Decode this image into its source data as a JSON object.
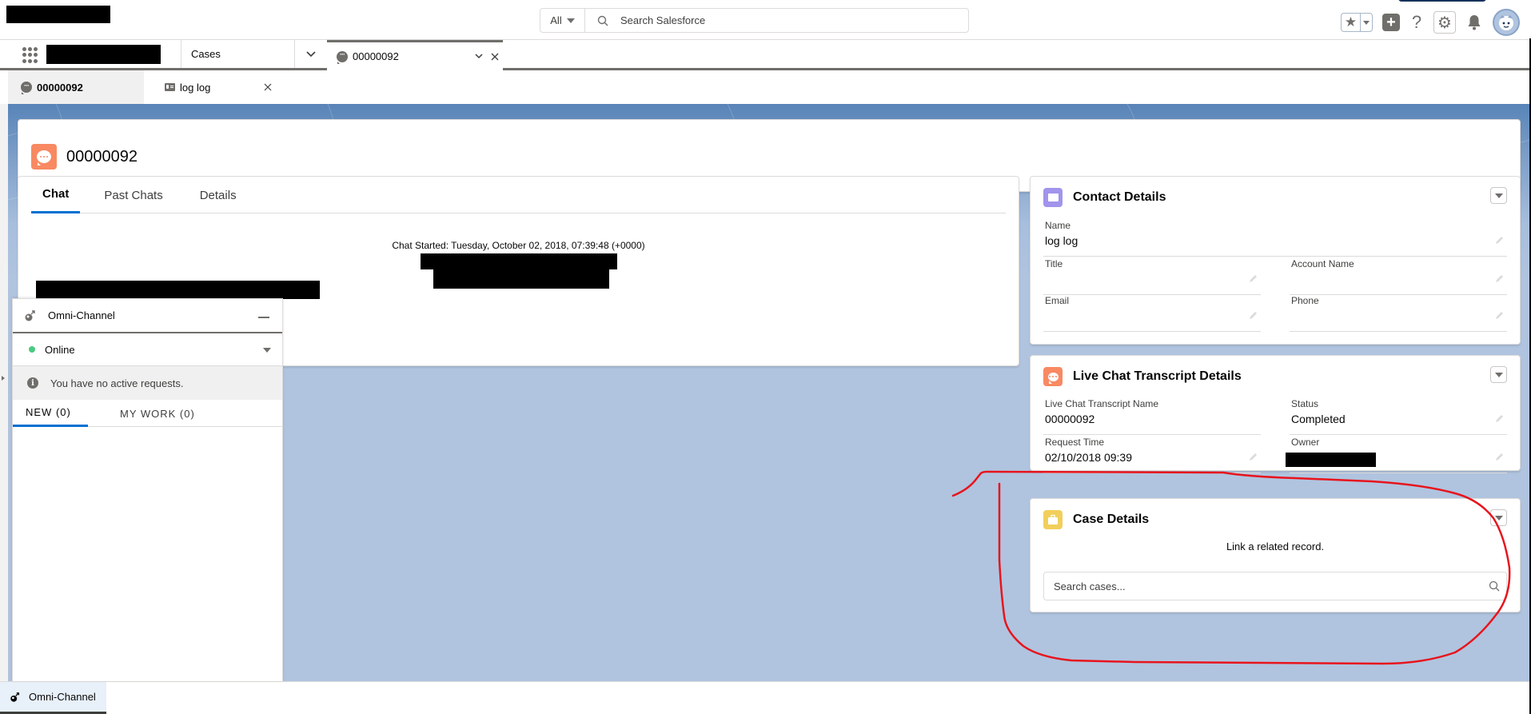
{
  "global_header": {
    "search_scope": "All",
    "search_placeholder": "Search Salesforce",
    "icons": [
      "favorites-star-icon",
      "favorites-dropdown-icon",
      "global-create-icon",
      "help-icon",
      "setup-gear-icon",
      "notifications-bell-icon",
      "user-avatar"
    ]
  },
  "nav": {
    "app_launcher_icon": "app-launcher-grid-icon",
    "object_tab_label": "Cases",
    "workspace_tab": {
      "label": "00000092",
      "icon": "chat-icon"
    }
  },
  "subtabs": [
    {
      "label": "00000092",
      "icon": "chat-icon",
      "active": true
    },
    {
      "label": "log log",
      "icon": "contact-icon",
      "active": false
    }
  ],
  "record": {
    "title": "00000092",
    "icon": "live-chat-transcript-icon",
    "icon_color": "#f88962"
  },
  "chat_card": {
    "tabs": [
      "Chat",
      "Past Chats",
      "Details"
    ],
    "active_tab": "Chat",
    "chat_started": "Chat Started: Tuesday, October 02, 2018, 07:39:48 (+0000)"
  },
  "contact_details": {
    "title": "Contact Details",
    "icon_color": "#a094ed",
    "fields": {
      "name_label": "Name",
      "name_value": "log log",
      "title_label": "Title",
      "title_value": "",
      "account_label": "Account Name",
      "account_value": "",
      "email_label": "Email",
      "email_value": "",
      "phone_label": "Phone",
      "phone_value": ""
    }
  },
  "transcript_details": {
    "title": "Live Chat Transcript Details",
    "icon_color": "#f88962",
    "fields": {
      "name_label": "Live Chat Transcript Name",
      "name_value": "00000092",
      "status_label": "Status",
      "status_value": "Completed",
      "request_time_label": "Request Time",
      "request_time_value": "02/10/2018 09:39",
      "owner_label": "Owner"
    }
  },
  "case_details": {
    "title": "Case Details",
    "icon_color": "#f2cf5b",
    "link_text": "Link a related record.",
    "search_placeholder": "Search cases..."
  },
  "omni_channel": {
    "title": "Omni-Channel",
    "status": "Online",
    "status_color": "#4bca81",
    "info_message": "You have no active requests.",
    "tabs": [
      "NEW (0)",
      "MY WORK (0)"
    ],
    "active_tab": "NEW (0)"
  },
  "utility_bar": {
    "items": [
      {
        "label": "Omni-Channel",
        "icon": "omni-channel-icon"
      }
    ]
  },
  "annotation": {
    "color": "#e8141c",
    "shape": "hand-drawn loop around Case Details card"
  },
  "colors": {
    "accent": "#0070d2",
    "workspace_bg": "#b0c4df"
  }
}
